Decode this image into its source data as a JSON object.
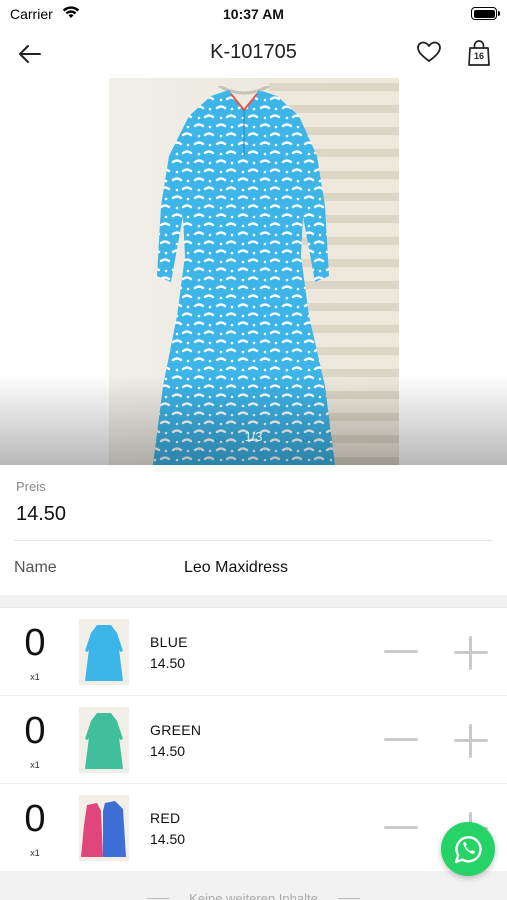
{
  "status_bar": {
    "carrier": "Carrier",
    "time": "10:37 AM"
  },
  "nav": {
    "title": "K-101705",
    "cart_count": "16"
  },
  "gallery": {
    "counter": "1/3",
    "dress_color": "#39b3e6"
  },
  "product": {
    "price_label": "Preis",
    "price": "14.50",
    "name_label": "Name",
    "name": "Leo Maxidress"
  },
  "variants": [
    {
      "qty": "0",
      "unit": "x1",
      "color": "BLUE",
      "price": "14.50",
      "swatch": "#39b3e6"
    },
    {
      "qty": "0",
      "unit": "x1",
      "color": "GREEN",
      "price": "14.50",
      "swatch": "#3fbf9b"
    },
    {
      "qty": "0",
      "unit": "x1",
      "color": "RED",
      "price": "14.50",
      "swatch": "#e0467c"
    }
  ],
  "footer": {
    "text": "Keine weiteren Inhalte"
  },
  "colors": {
    "whatsapp": "#25d366",
    "divider": "#e6e6e6"
  }
}
